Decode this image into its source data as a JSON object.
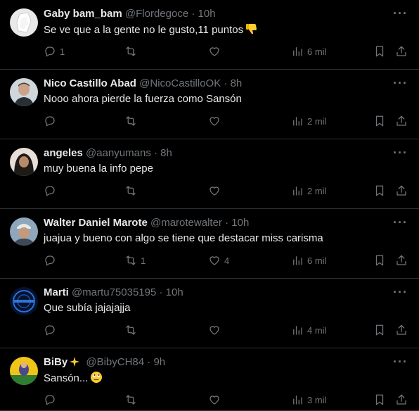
{
  "icons": [
    "reply-icon",
    "retweet-icon",
    "like-icon",
    "views-icon",
    "bookmark-icon",
    "share-icon",
    "more-icon"
  ],
  "colors": {
    "background": "#000000",
    "text": "#e7e9ea",
    "muted": "#71767b",
    "divider": "#2f3336"
  },
  "tweets": [
    {
      "name": "Gaby bam_bam",
      "handle": "@Flordegoce",
      "dot": "·",
      "time": "10h",
      "text": "Se ve que a la gente no le gusto,11 puntos",
      "emoji": "thumbs-down",
      "replies": "1",
      "retweets": "",
      "likes": "",
      "views": "6 mil",
      "more": "···"
    },
    {
      "name": "Nico Castillo Abad",
      "handle": "@NicoCastilloOK",
      "dot": "·",
      "time": "8h",
      "text": "Nooo ahora pierde la fuerza como Sansón",
      "emoji": "",
      "replies": "",
      "retweets": "",
      "likes": "",
      "views": "2 mil",
      "more": "···"
    },
    {
      "name": "angeles",
      "handle": "@aanyumans",
      "dot": "·",
      "time": "8h",
      "text": "muy buena la info pepe",
      "emoji": "",
      "replies": "",
      "retweets": "",
      "likes": "",
      "views": "2 mil",
      "more": "···"
    },
    {
      "name": "Walter Daniel Marote",
      "handle": "@marotewalter",
      "dot": "·",
      "time": "10h",
      "text": "juajua y bueno con algo se tiene que destacar miss carisma",
      "emoji": "",
      "replies": "",
      "retweets": "1",
      "likes": "4",
      "views": "6 mil",
      "more": "···"
    },
    {
      "name": "Marti",
      "handle": "@martu75035195",
      "dot": "·",
      "time": "10h",
      "text": "Que subía jajajajja",
      "emoji": "",
      "replies": "",
      "retweets": "",
      "likes": "",
      "views": "4 mil",
      "more": "···"
    },
    {
      "name": "BiBy",
      "handle": "@BibyCH84",
      "dot": "·",
      "time": "9h",
      "text": "Sansón...",
      "emoji": "rolling-eyes",
      "replies": "",
      "retweets": "",
      "likes": "",
      "views": "3 mil",
      "more": "···"
    }
  ]
}
